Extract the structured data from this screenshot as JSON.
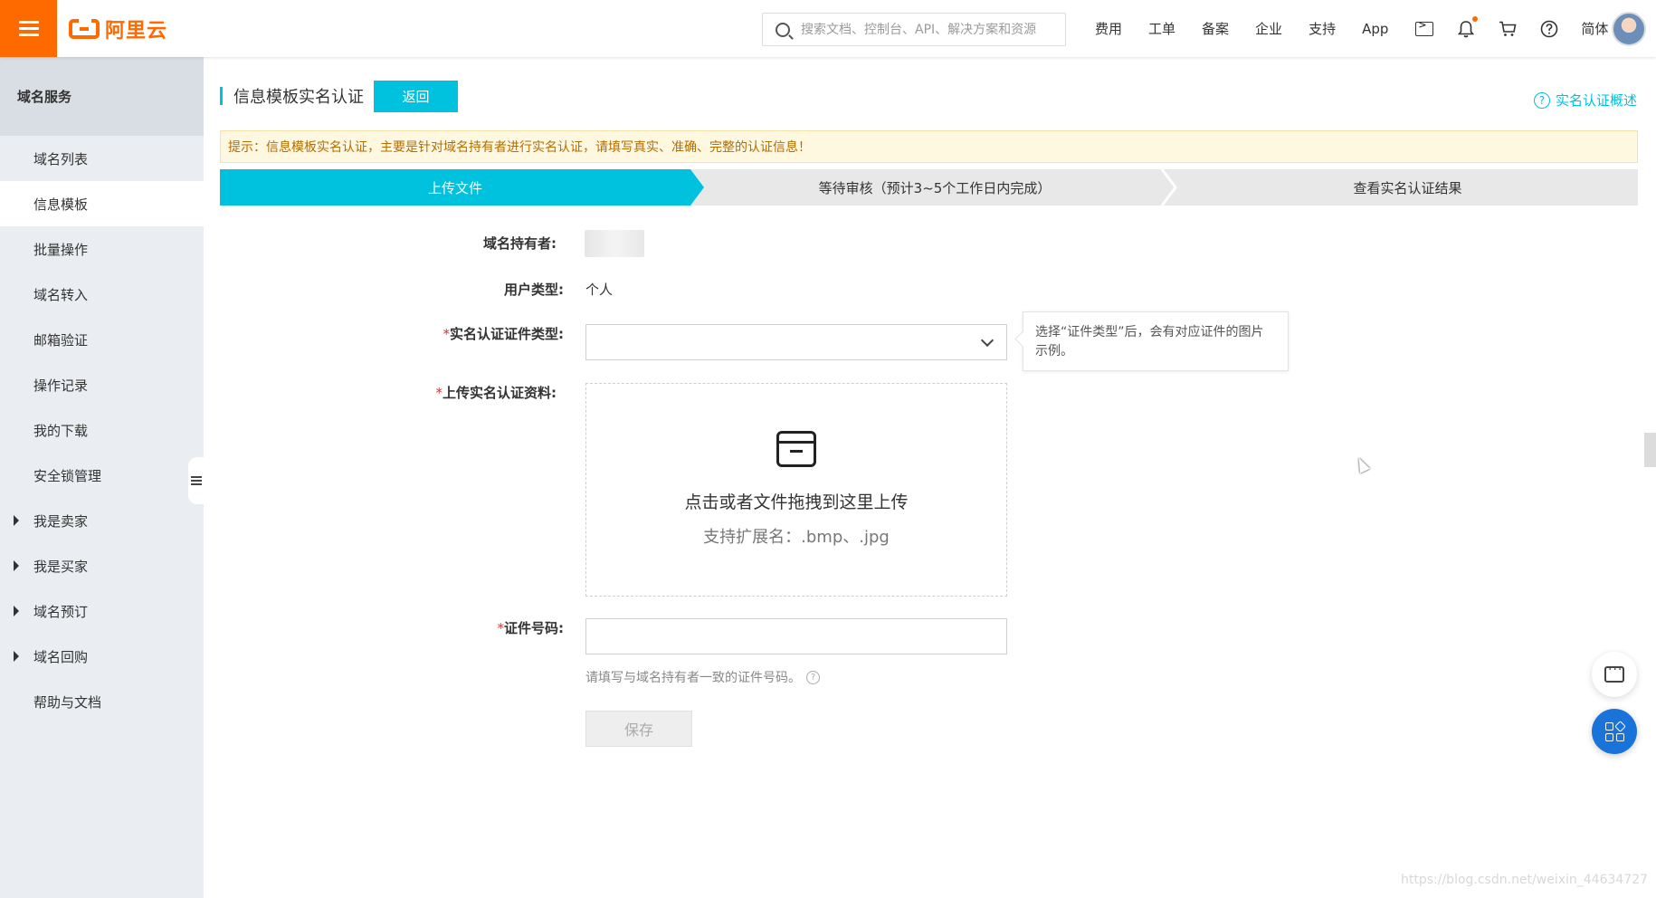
{
  "topbar": {
    "logo_text": "阿里云",
    "search_placeholder": "搜索文档、控制台、API、解决方案和资源",
    "nav": [
      "费用",
      "工单",
      "备案",
      "企业",
      "支持",
      "App"
    ],
    "lang": "简体",
    "icons": [
      "terminal-icon",
      "bell-icon",
      "cart-icon",
      "help-icon"
    ],
    "accent": "#ff6a00"
  },
  "sidebar": {
    "title": "域名服务",
    "items": [
      {
        "label": "域名列表",
        "expandable": false
      },
      {
        "label": "信息模板",
        "expandable": false,
        "active": true
      },
      {
        "label": "批量操作",
        "expandable": false
      },
      {
        "label": "域名转入",
        "expandable": false
      },
      {
        "label": "邮箱验证",
        "expandable": false
      },
      {
        "label": "操作记录",
        "expandable": false
      },
      {
        "label": "我的下载",
        "expandable": false
      },
      {
        "label": "安全锁管理",
        "expandable": false
      },
      {
        "label": "我是卖家",
        "expandable": true
      },
      {
        "label": "我是买家",
        "expandable": true
      },
      {
        "label": "域名预订",
        "expandable": true
      },
      {
        "label": "域名回购",
        "expandable": true
      },
      {
        "label": "帮助与文档",
        "expandable": false
      }
    ]
  },
  "page": {
    "title": "信息模板实名认证",
    "back_label": "返回",
    "overview_link": "实名认证概述",
    "tip": "提示：信息模板实名认证，主要是针对域名持有者进行实名认证，请填写真实、准确、完整的认证信息！",
    "steps": [
      "上传文件",
      "等待审核（预计3~5个工作日内完成）",
      "查看实名认证结果"
    ],
    "active_step_color": "#00c1de"
  },
  "form": {
    "owner_label": "域名持有者:",
    "user_type_label": "用户类型:",
    "user_type_value": "个人",
    "cert_type_label": "实名认证证件类型:",
    "cert_type_hint": "选择“证件类型”后，会有对应证件的图片示例。",
    "upload_label": "上传实名认证资料:",
    "upload_main": "点击或者文件拖拽到这里上传",
    "upload_sub": "支持扩展名：.bmp、.jpg",
    "id_label": "证件号码:",
    "id_help": "请填写与域名持有者一致的证件号码。",
    "save_label": "保存",
    "required_mark": "*"
  },
  "watermark": "https://blog.csdn.net/weixin_44634727"
}
